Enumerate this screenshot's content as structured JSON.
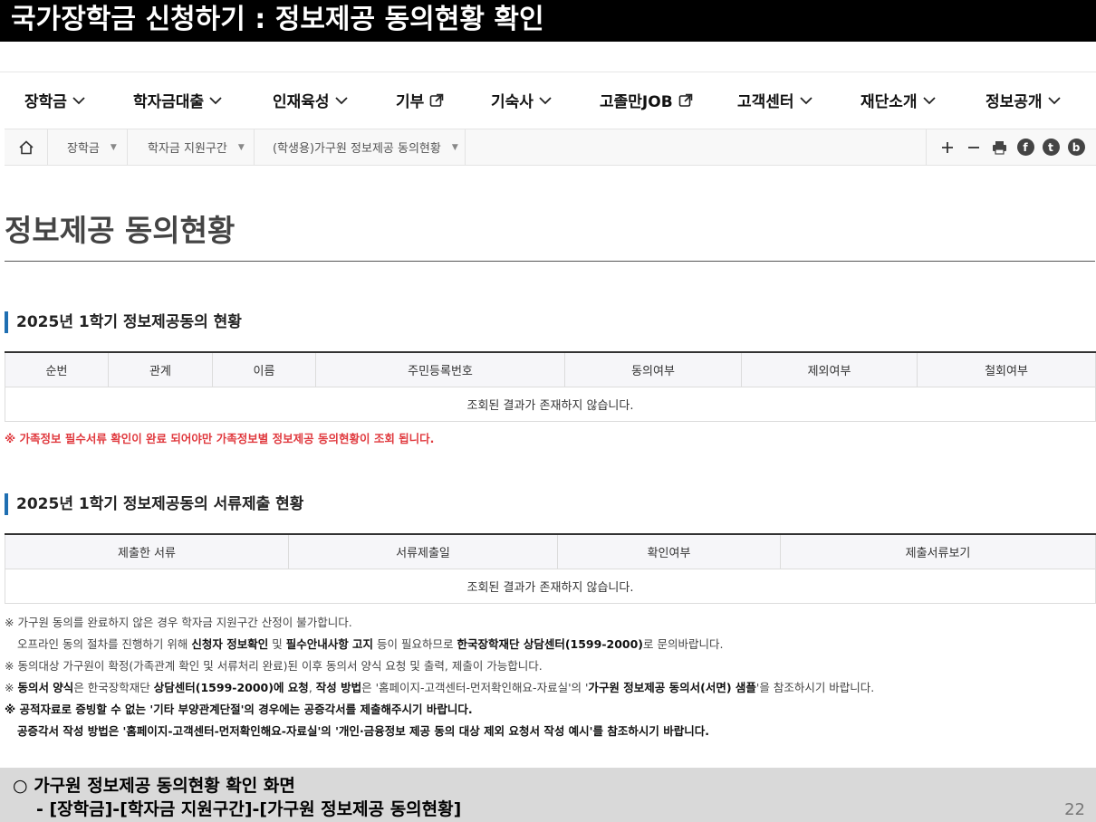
{
  "slide": {
    "heading": "국가장학금 신청하기 : 정보제공 동의현황 확인",
    "caption_line1": "○ 가구원 정보제공 동의현황 확인 화면",
    "caption_line2": "- [장학금]-[학자금 지원구간]-[가구원 정보제공 동의현황]",
    "page_number": "22"
  },
  "nav": {
    "items": [
      {
        "label": "장학금",
        "icon": "chevron-down-icon"
      },
      {
        "label": "학자금대출",
        "icon": "chevron-down-icon"
      },
      {
        "label": "인재육성",
        "icon": "chevron-down-icon"
      },
      {
        "label": "기부",
        "icon": "external-link-icon"
      },
      {
        "label": "기숙사",
        "icon": "chevron-down-icon"
      },
      {
        "label": "고졸만JOB",
        "icon": "external-link-icon"
      },
      {
        "label": "고객센터",
        "icon": "chevron-down-icon"
      },
      {
        "label": "재단소개",
        "icon": "chevron-down-icon"
      },
      {
        "label": "정보공개",
        "icon": "chevron-down-icon"
      }
    ]
  },
  "breadcrumb": {
    "home_icon": "home-icon",
    "items": [
      "장학금",
      "학자금 지원구간",
      "(학생용)가구원 정보제공 동의현황"
    ],
    "tools": [
      "plus-icon",
      "minus-icon",
      "print-icon",
      "facebook-icon",
      "twitter-icon",
      "blog-icon"
    ],
    "sns": {
      "facebook": "f",
      "twitter": "t",
      "blog": "b"
    }
  },
  "main": {
    "page_title": "정보제공 동의현황",
    "section1": {
      "title": "2025년 1학기 정보제공동의 현황",
      "headers": [
        "순번",
        "관계",
        "이름",
        "주민등록번호",
        "동의여부",
        "제외여부",
        "철회여부"
      ],
      "empty_message": "조회된 결과가 존재하지 않습니다.",
      "warning": "※ 가족정보 필수서류 확인이 완료 되어야만 가족정보별 정보제공 동의현황이 조회 됩니다."
    },
    "section2": {
      "title": "2025년 1학기 정보제공동의 서류제출 현황",
      "headers": [
        "제출한 서류",
        "서류제출일",
        "확인여부",
        "제출서류보기"
      ],
      "empty_message": "조회된 결과가 존재하지 않습니다."
    },
    "notes": {
      "n1": "※ 가구원 동의를 완료하지 않은 경우 학자금 지원구간 산정이 불가합니다.",
      "n2_a": "오프라인 동의 절차를 진행하기 위해 ",
      "n2_b": "신청자 정보확인",
      "n2_c": " 및 ",
      "n2_d": "필수안내사항 고지",
      "n2_e": " 등이 필요하므로 ",
      "n2_f": "한국장학재단 상담센터(1599-2000)",
      "n2_g": "로 문의바랍니다.",
      "n3": "※ 동의대상 가구원이 확정(가족관계 확인 및 서류처리 완료)된 이후 동의서 양식 요청 및 출력, 제출이 가능합니다.",
      "n4_a": "※ ",
      "n4_b": "동의서 양식",
      "n4_c": "은 한국장학재단 ",
      "n4_d": "상담센터(1599-2000)에 요청",
      "n4_e": ", ",
      "n4_f": "작성 방법",
      "n4_g": "은 '홈페이지-고객센터-먼저확인해요-자료실'의 '",
      "n4_h": "가구원 정보제공 동의서(서면) 샘플",
      "n4_i": "'을 참조하시기 바랍니다.",
      "n5": "※ 공적자료로 증빙할 수 없는 '기타 부양관계단절'의 경우에는 공증각서를 제출해주시기 바랍니다.",
      "n6": "공증각서 작성 방법은 '홈페이지-고객센터-먼저확인해요-자료실'의 '개인·금융정보 제공 동의 대상 제외 요청서 작성 예시'를 참조하시기 바랍니다."
    }
  }
}
